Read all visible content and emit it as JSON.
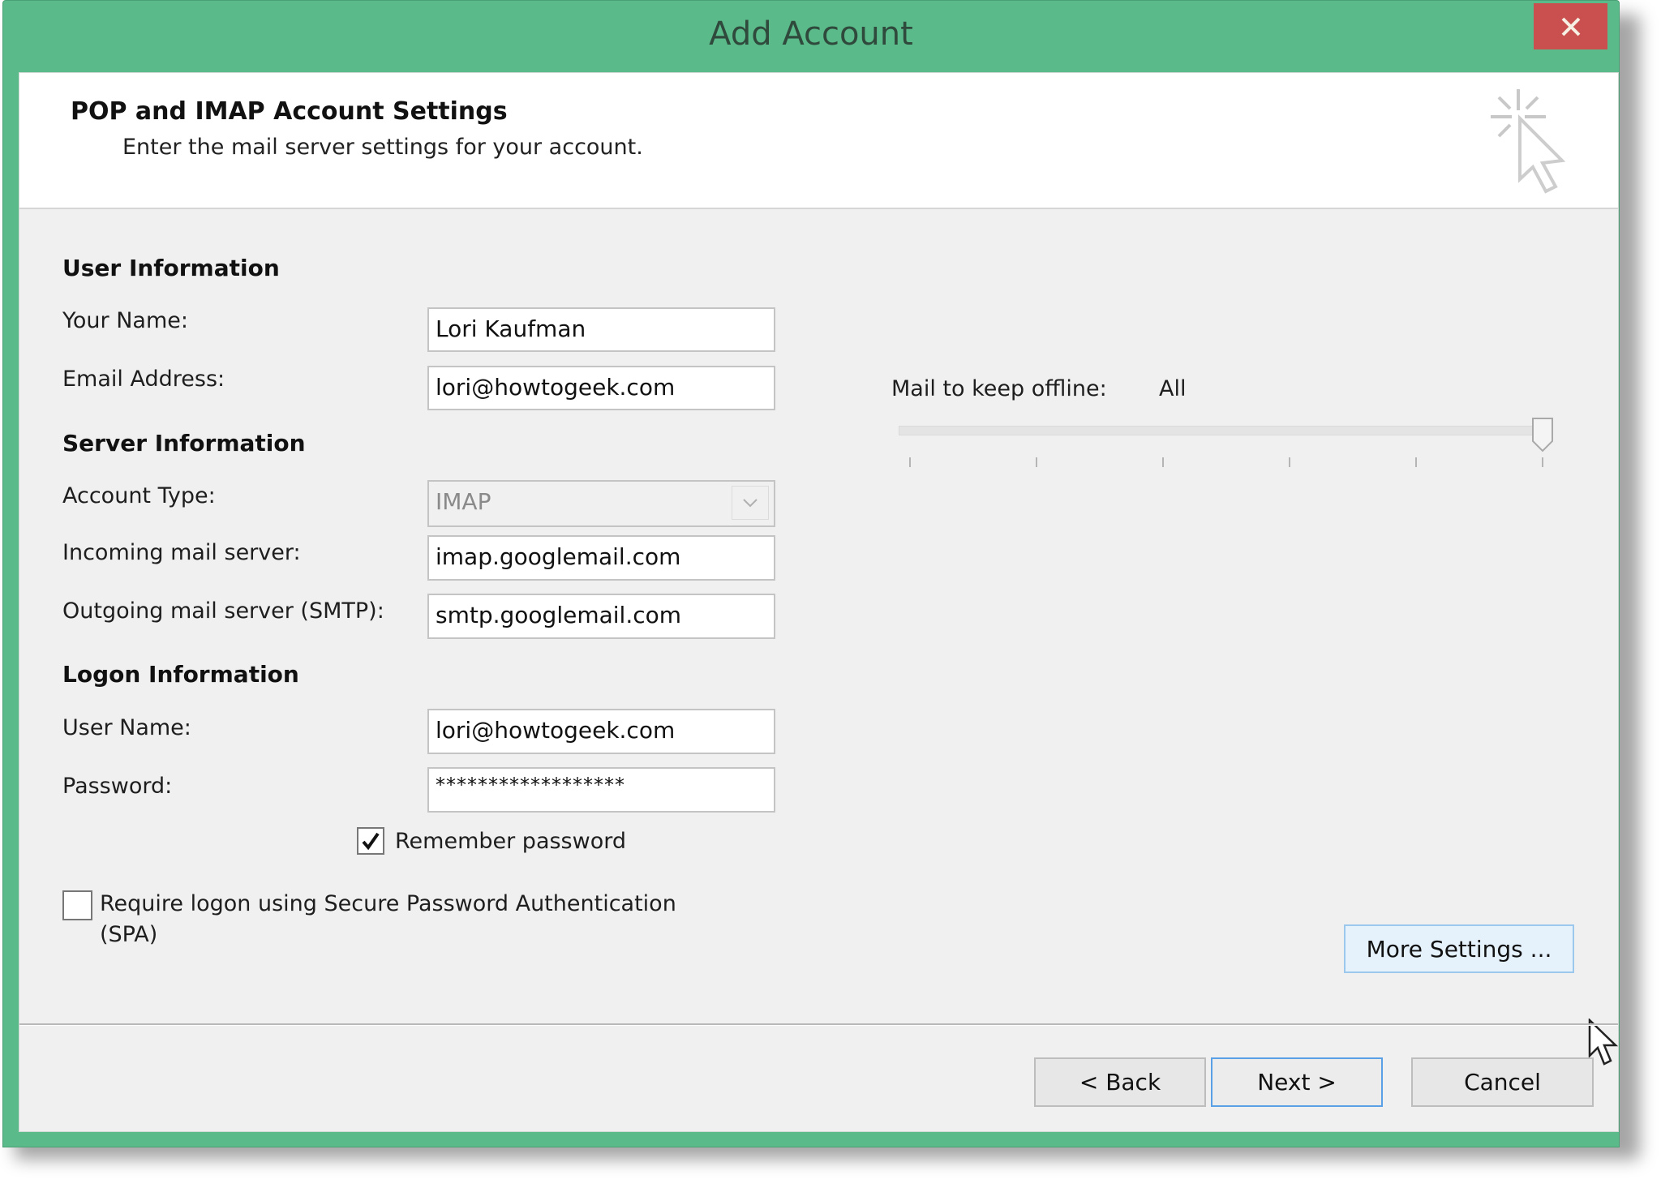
{
  "window": {
    "title": "Add Account",
    "close_icon": "close-icon"
  },
  "header": {
    "title": "POP and IMAP Account Settings",
    "subtitle": "Enter the mail server settings for your account.",
    "icon": "cursor-click-icon"
  },
  "user_info": {
    "section_label": "User Information",
    "name_label": "Your Name:",
    "name_value": "Lori Kaufman",
    "email_label": "Email Address:",
    "email_value": "lori@howtogeek.com"
  },
  "server_info": {
    "section_label": "Server Information",
    "account_type_label": "Account Type:",
    "account_type_value": "IMAP",
    "incoming_label": "Incoming mail server:",
    "incoming_value": "imap.googlemail.com",
    "outgoing_label": "Outgoing mail server (SMTP):",
    "outgoing_value": "smtp.googlemail.com"
  },
  "logon_info": {
    "section_label": "Logon Information",
    "username_label": "User Name:",
    "username_value": "lori@howtogeek.com",
    "password_label": "Password:",
    "password_value": "******************",
    "remember_label": "Remember password",
    "remember_checked": true,
    "spa_label_line1": "Require logon using Secure Password Authentication",
    "spa_label_line2": "(SPA)",
    "spa_checked": false
  },
  "offline": {
    "label": "Mail to keep offline:",
    "value": "All",
    "slider_position": 1.0,
    "slider_steps": 6
  },
  "buttons": {
    "more_settings": "More Settings ...",
    "back": "< Back",
    "next": "Next >",
    "cancel": "Cancel"
  },
  "colors": {
    "frame": "#5bba8a",
    "close": "#c9504f",
    "focus": "#5aa0e6"
  }
}
